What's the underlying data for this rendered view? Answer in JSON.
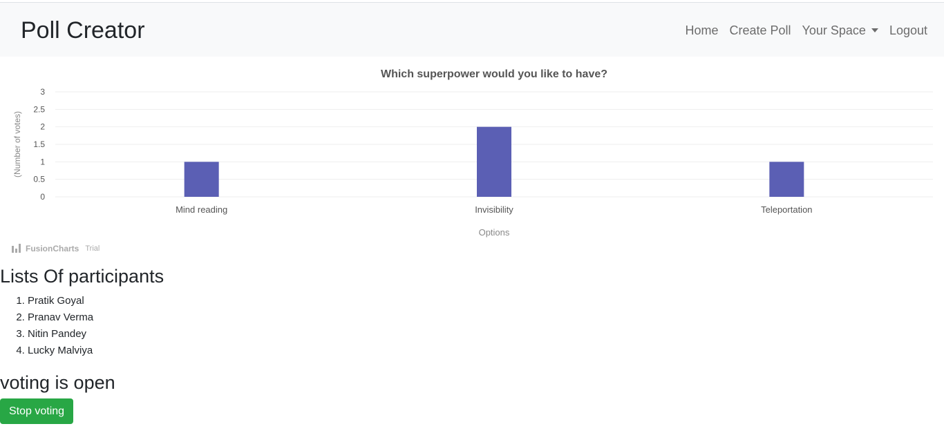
{
  "navbar": {
    "brand": "Poll Creator",
    "links": [
      "Home",
      "Create Poll",
      "Your Space",
      "Logout"
    ]
  },
  "chart_data": {
    "type": "bar",
    "title": "Which superpower would you like to have?",
    "xlabel": "Options",
    "ylabel": "(Number of votes)",
    "categories": [
      "Mind reading",
      "Invisibility",
      "Teleportation"
    ],
    "values": [
      1,
      2,
      1
    ],
    "ylim": [
      0,
      3
    ],
    "yticks": [
      "0",
      "0.5",
      "1",
      "1.5",
      "2",
      "2.5",
      "3"
    ],
    "grid": true,
    "bar_color": "#5b5fb4"
  },
  "branding": {
    "name": "FusionCharts",
    "suffix": "Trial"
  },
  "participants": {
    "title": "Lists Of participants",
    "items": [
      "Pratik Goyal",
      "Pranav Verma",
      "Nitin Pandey",
      "Lucky Malviya"
    ]
  },
  "voting": {
    "status": "voting is open",
    "button_label": "Stop voting",
    "button_color": "#28a745"
  }
}
